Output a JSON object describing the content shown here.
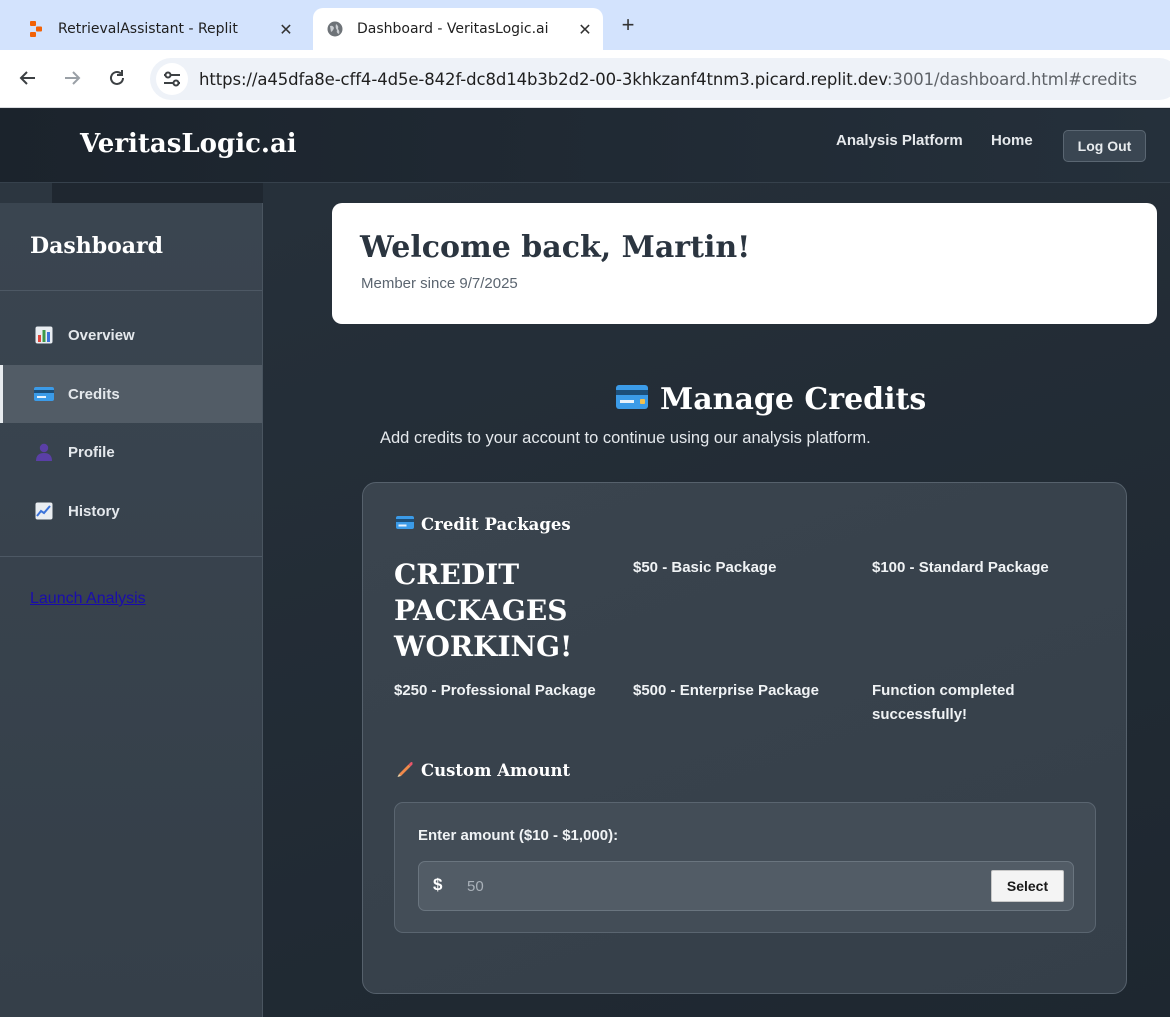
{
  "browser": {
    "tabs": [
      {
        "title": "RetrievalAssistant - Replit",
        "icon": "replit-icon",
        "active": false
      },
      {
        "title": "Dashboard - VeritasLogic.ai",
        "icon": "globe-icon",
        "active": true
      }
    ],
    "new_tab_label": "+",
    "close_glyph": "✕",
    "url_main": "https://a45dfa8e-cff4-4d5e-842f-dc8d14b3b2d2-00-3khkzanf4tnm3.picard.replit.dev",
    "url_rest": ":3001/dashboard.html#credits"
  },
  "header": {
    "brand": "VeritasLogic.ai",
    "nav": [
      "Analysis Platform",
      "Home"
    ],
    "logout_label": "Log Out"
  },
  "sidebar": {
    "title": "Dashboard",
    "items": [
      {
        "label": "Overview",
        "icon": "bar-chart-icon",
        "active": false
      },
      {
        "label": "Credits",
        "icon": "credit-card-icon",
        "active": true
      },
      {
        "label": "Profile",
        "icon": "person-icon",
        "active": false
      },
      {
        "label": "History",
        "icon": "line-chart-icon",
        "active": false
      }
    ],
    "launch_link": "Launch Analysis"
  },
  "welcome": {
    "heading": "Welcome back, Martin!",
    "member_since": "Member since 9/7/2025"
  },
  "credits": {
    "title": "Manage Credits",
    "subtitle": "Add credits to your account to continue using our analysis platform.",
    "packages_heading": "Credit Packages",
    "status_message": "CREDIT PACKAGES WORKING!",
    "packages": [
      "$50 - Basic Package",
      "$100 - Standard Package",
      "$250 - Professional Package",
      "$500 - Enterprise Package",
      "Function completed successfully!"
    ],
    "custom_heading": "Custom Amount",
    "custom_label": "Enter amount ($10 - $1,000):",
    "currency_symbol": "$",
    "amount_placeholder": "50",
    "select_label": "Select"
  },
  "colors": {
    "accent_card": "#3b9be8",
    "header_bg": "#1b232c",
    "sidebar_bg": "#3a4550",
    "link": "#1a0dab"
  }
}
